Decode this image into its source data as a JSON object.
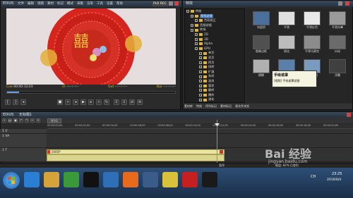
{
  "player": {
    "app_name": "EDIUS",
    "menu": [
      "文件",
      "编辑",
      "视图",
      "素材",
      "标记",
      "模式",
      "采集",
      "渲染",
      "工具",
      "设置",
      "帮助"
    ],
    "mode_badge": "PLR REC",
    "cue_label": "Cue",
    "cue_value": "00:00:12;03",
    "in_label": "In",
    "in_value": "--:--:--:--",
    "out_label": "Out",
    "out_value": "--:--:--:--",
    "dur_label": "Dur",
    "dur_value": "--:--:--:--",
    "video_caption": "囍"
  },
  "library": {
    "title": "特效",
    "tree": [
      {
        "label": "特效",
        "depth": 0,
        "selected": false
      },
      {
        "label": "视频滤镜",
        "depth": 1,
        "selected": true
      },
      {
        "label": "色彩校正",
        "depth": 2,
        "selected": false
      },
      {
        "label": "音频滤镜",
        "depth": 1,
        "selected": false
      },
      {
        "label": "转场",
        "depth": 1,
        "selected": false
      },
      {
        "label": "2D",
        "depth": 2,
        "selected": false
      },
      {
        "label": "3D",
        "depth": 2,
        "selected": false
      },
      {
        "label": "Alpha",
        "depth": 2,
        "selected": false
      },
      {
        "label": "GPU",
        "depth": 2,
        "selected": false
      },
      {
        "label": "单页",
        "depth": 3,
        "selected": false
      },
      {
        "label": "双页",
        "depth": 3,
        "selected": false
      },
      {
        "label": "四页",
        "depth": 3,
        "selected": false
      },
      {
        "label": "扭转",
        "depth": 3,
        "selected": false
      },
      {
        "label": "扩展",
        "depth": 3,
        "selected": false
      },
      {
        "label": "条纹",
        "depth": 3,
        "selected": false
      },
      {
        "label": "波浪",
        "depth": 3,
        "selected": false
      },
      {
        "label": "管状",
        "depth": 3,
        "selected": false
      },
      {
        "label": "翻转",
        "depth": 3,
        "selected": false
      },
      {
        "label": "爆炸",
        "depth": 3,
        "selected": false
      },
      {
        "label": "溶化",
        "depth": 3,
        "selected": false
      },
      {
        "label": "SMPTE",
        "depth": 2,
        "selected": false
      }
    ],
    "thumbs": [
      {
        "label": "块面积",
        "color": "#4a6f9a"
      },
      {
        "label": "平滑",
        "color": "#e0e0e0"
      },
      {
        "label": "平滑反色",
        "color": "#e8e8e8"
      },
      {
        "label": "平滑光晕",
        "color": "#9a9a9a"
      },
      {
        "label": "图像边框",
        "color": "#505050"
      },
      {
        "label": "锐化",
        "color": "#bcbcbc"
      },
      {
        "label": "平滑马赛克",
        "color": "#8c8c8c"
      },
      {
        "label": "抖动",
        "color": "#6b6b6b"
      },
      {
        "label": "模糊",
        "color": "#b0b0b0"
      },
      {
        "label": "手绘遮罩",
        "color": "#5a7fa8"
      },
      {
        "label": "组合滤镜",
        "color": "#7a9bc0"
      },
      {
        "label": "浮雕",
        "color": "#404040"
      }
    ],
    "tooltip_title": "手绘遮罩",
    "tooltip_sub": "[视频] 手绘遮罩滤镜",
    "tabs": [
      "素材库",
      "特效",
      "序列标记",
      "素材标记",
      "源文件浏览"
    ]
  },
  "timeline": {
    "title": "无标题1",
    "sequence_tab": "序列1",
    "tracks": [
      {
        "name": "V",
        "label": "1 V"
      },
      {
        "name": "VA",
        "label": "1 VA"
      },
      {
        "name": "T",
        "label": "1 T"
      },
      {
        "name": "A",
        "label": "1 A"
      }
    ],
    "ruler_times": [
      "00:00:00;00",
      "00:00:02;00",
      "00:00:04;00",
      "00:00:06;00",
      "00:00:08;00",
      "00:00:10;00",
      "00:00:12;00",
      "00:00:14;00",
      "00:00:16;00",
      "00:00:18;00",
      "00:00:20;00"
    ],
    "clip_name": "3085P",
    "status_text": "暂停",
    "status_disk": "磁盘: 82% 已使用"
  },
  "taskbar": {
    "start": "Windows",
    "time": "23:25",
    "date": "2016/8/4",
    "lang": "CH"
  },
  "watermark": {
    "main": "Bai 经验",
    "sub": "jingyan.baidu.com"
  },
  "colors": {
    "titlebar": "#2b3a4b",
    "clip": "#e9e4a6",
    "playhead": "#4fa0e0",
    "taskbar": "#2d4e75"
  }
}
